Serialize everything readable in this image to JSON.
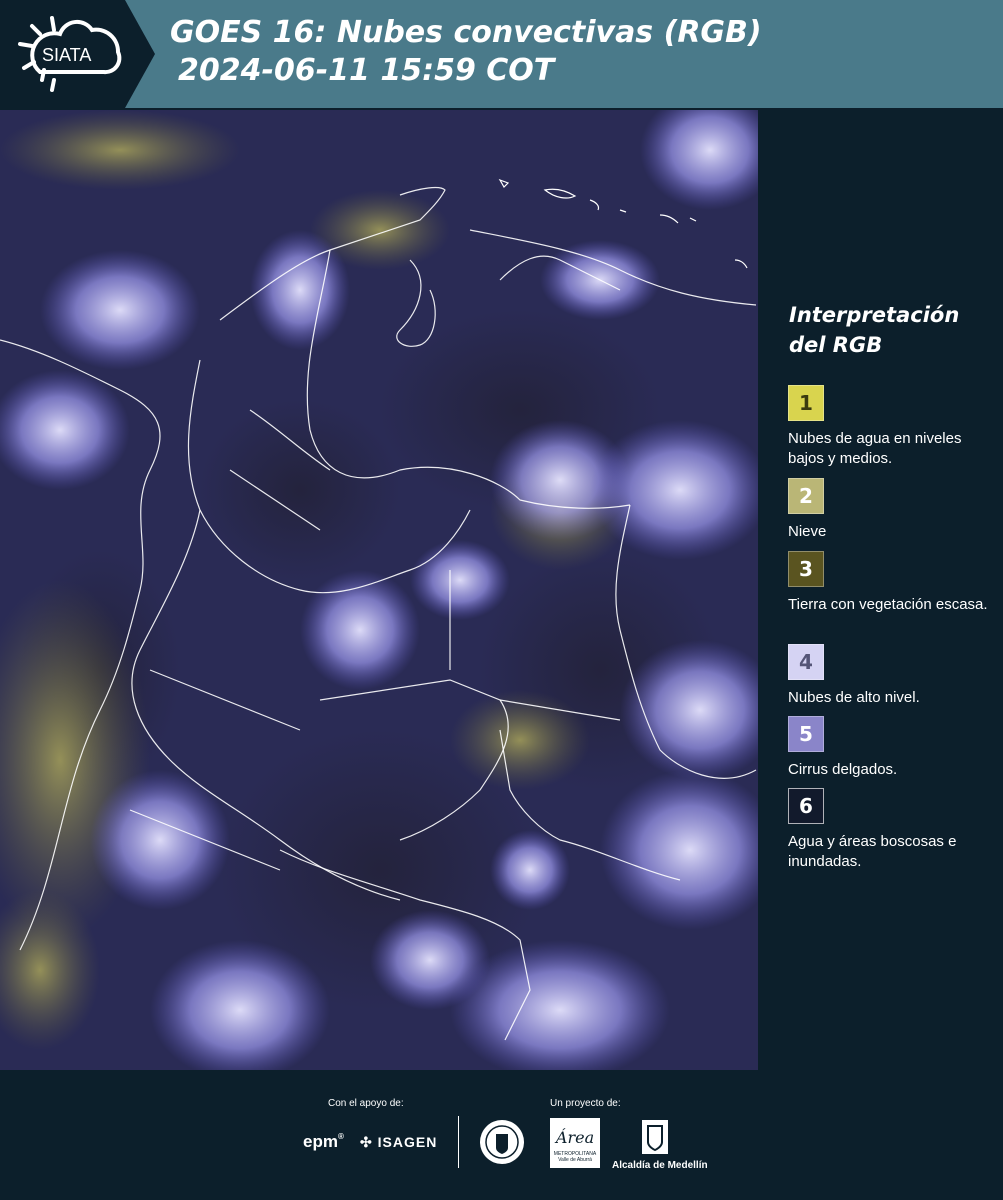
{
  "header": {
    "logo_text": "SIATA",
    "title_line1": "GOES 16: Nubes convectivas (RGB)",
    "title_line2": "2024-06-11 15:59 COT"
  },
  "legend": {
    "title": "Interpretación del RGB",
    "items": [
      {
        "number": "1",
        "color": "#d9d44e",
        "text_color": "#3a3a10",
        "label": "Nubes de agua en niveles bajos y medios."
      },
      {
        "number": "2",
        "color": "#bab676",
        "text_color": "#ffffff",
        "label": "Nieve"
      },
      {
        "number": "3",
        "color": "#5a5420",
        "text_color": "#ffffff",
        "label": "Tierra con vegetación escasa."
      },
      {
        "number": "4",
        "color": "#d5d3f3",
        "text_color": "#555577",
        "label": "Nubes de alto nivel."
      },
      {
        "number": "5",
        "color": "#8a85c9",
        "text_color": "#ffffff",
        "label": "Cirrus delgados."
      },
      {
        "number": "6",
        "color": "#121a2c",
        "text_color": "#ffffff",
        "label": "Agua y áreas boscosas e inundadas."
      }
    ]
  },
  "footer": {
    "support_label": "Con el apoyo de:",
    "project_label": "Un proyecto de:",
    "sponsor_epm": "epm",
    "sponsor_isagen": "ISAGEN",
    "area_logo_text": "Área",
    "area_subtext": "METROPOLITANA",
    "area_subtext2": "Valle de Aburrá",
    "alcaldia_label": "Alcaldía de Medellín"
  }
}
